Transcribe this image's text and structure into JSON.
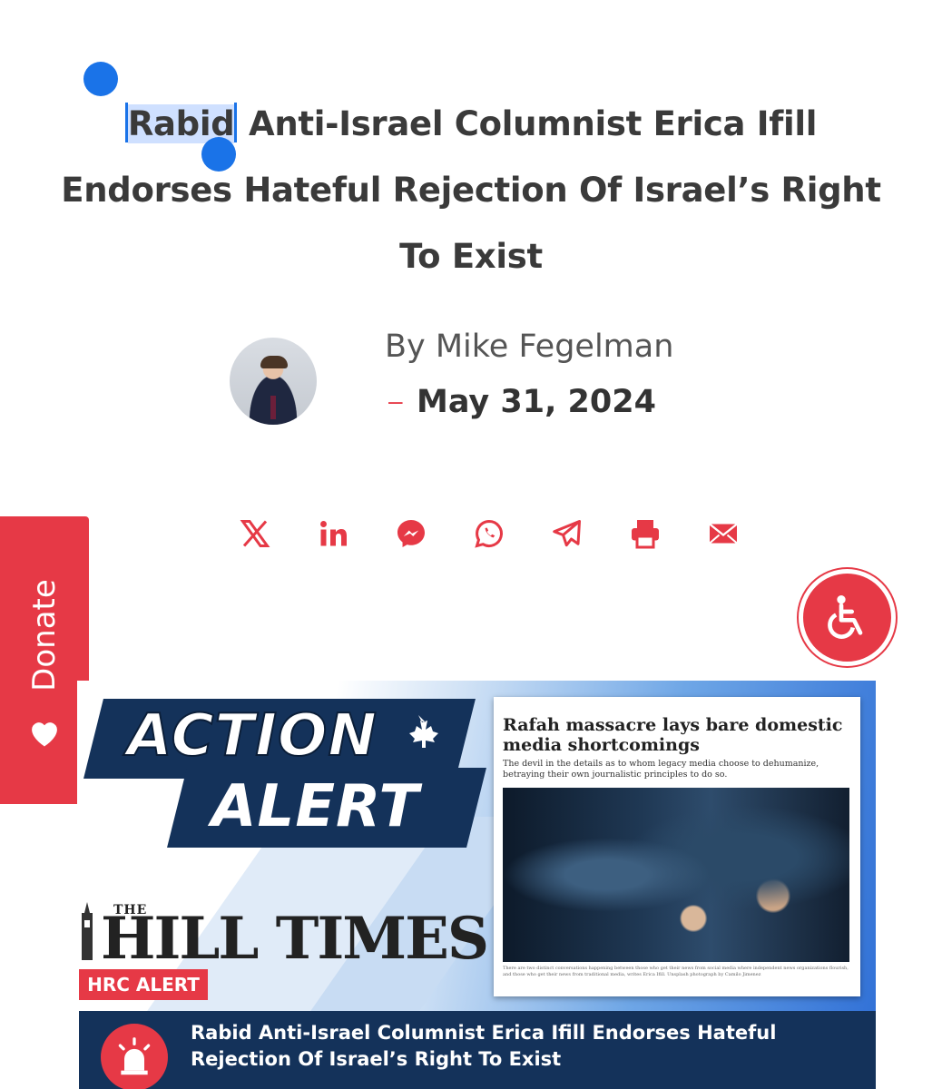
{
  "article": {
    "title_selected": "Rabid",
    "title_rest": " Anti-Israel Columnist Erica Ifill Endorses Hateful Rejection Of Israel’s Right To Exist",
    "byline": "By Mike Fegelman",
    "date_dash": "–",
    "date": "May 31, 2024"
  },
  "share": {
    "icons": [
      "x-icon",
      "linkedin-icon",
      "messenger-icon",
      "whatsapp-icon",
      "telegram-icon",
      "print-icon",
      "email-icon"
    ]
  },
  "donate": {
    "label": "Donate"
  },
  "colors": {
    "accent": "#e63946",
    "navy": "#14325a",
    "selection": "#1a73e8"
  },
  "banner": {
    "action": "ACTION",
    "alert": "ALERT",
    "publication_the": "THE",
    "publication": "HILL TIMES",
    "hrc_label": "HRC ALERT",
    "footer_title": "Rabid Anti-Israel Columnist Erica Ifill Endorses Hateful Rejection Of Israel’s Right To Exist",
    "card_title": "Rafah massacre lays bare domestic media shortcomings",
    "card_dek": "The devil in the details as to whom legacy media choose to dehumanize, betraying their own journalistic principles to do so.",
    "card_caption": "There are two distinct conversations happening between those who get their news from social media where independent news organizations flourish, and those who get their news from traditional media, writes Erica Ifill. Unsplash photograph by Camilo Jimenez"
  }
}
